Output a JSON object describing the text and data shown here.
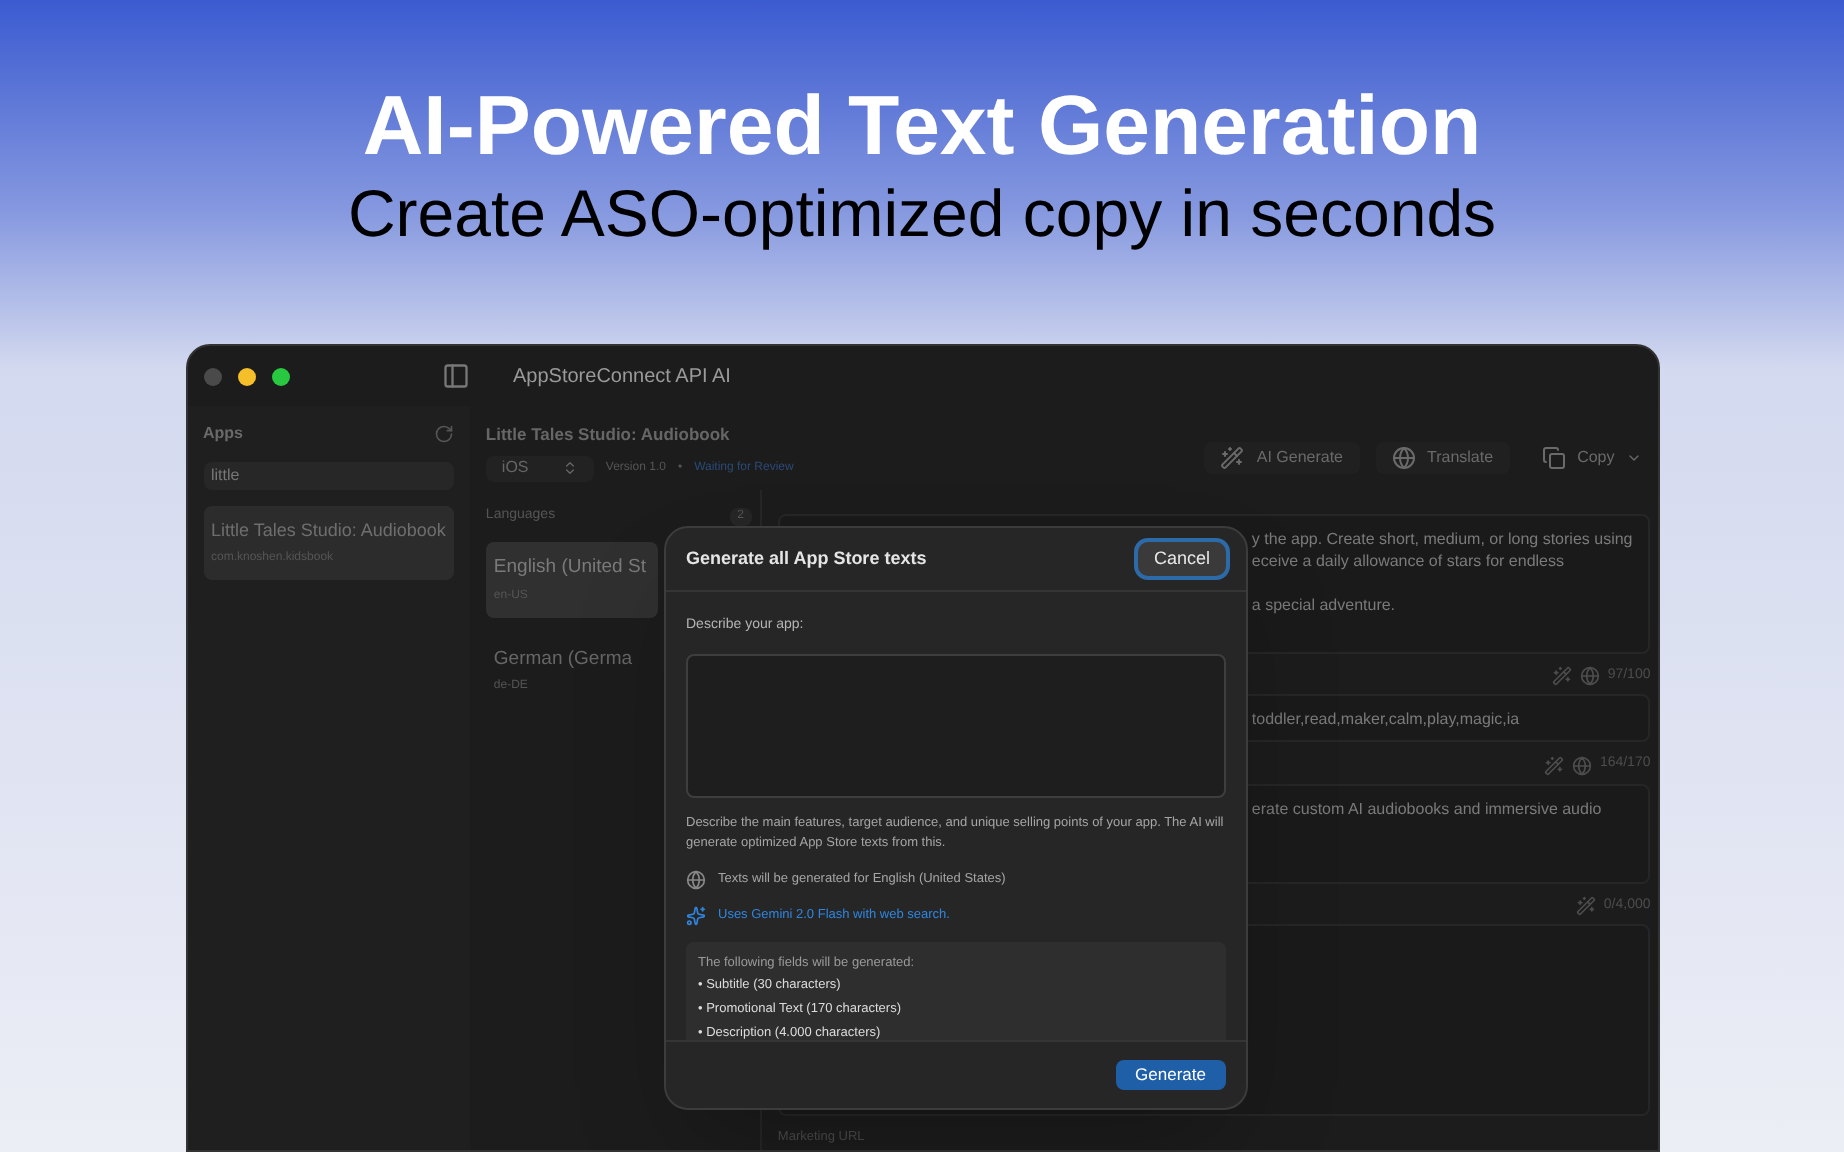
{
  "hero": {
    "title": "AI-Powered Text Generation",
    "subtitle": "Create ASO-optimized copy in seconds"
  },
  "window": {
    "title": "AppStoreConnect API AI"
  },
  "sidebar": {
    "heading": "Apps",
    "search": {
      "value": "little"
    },
    "items": [
      {
        "name": "Little Tales Studio: Audiobook",
        "bundle_id": "com.knoshen.kidsbook",
        "selected": true
      }
    ]
  },
  "app_header": {
    "name": "Little Tales Studio: Audiobook",
    "platform": "iOS",
    "version": "Version 1.0",
    "separator": "•",
    "status": "Waiting for Review"
  },
  "toolbar": [
    {
      "label": "AI Generate",
      "kind": "ai"
    },
    {
      "label": "Translate",
      "kind": "translate"
    },
    {
      "label": "Copy",
      "kind": "copy"
    }
  ],
  "languages": {
    "heading": "Languages",
    "count": "2",
    "items": [
      {
        "name": "English (United St",
        "code": "en-US",
        "selected": true
      },
      {
        "name": "German (Germa",
        "code": "de-DE",
        "selected": false
      }
    ]
  },
  "fields": [
    {
      "kind": "text",
      "paragraphs": [
        [
          "y the app. Create short, medium, or long stories using",
          "eceive a daily allowance of stars for endless"
        ],
        [
          "a special adventure."
        ]
      ]
    },
    {
      "kind": "keywords",
      "counter": "97/100",
      "paragraphs": [
        [
          "toddler,read,maker,calm,play,magic,ia"
        ]
      ]
    },
    {
      "kind": "promo",
      "counter": "164/170",
      "paragraphs": [
        [
          "erate custom AI audiobooks and immersive audio"
        ]
      ]
    },
    {
      "kind": "description",
      "counter": "0/4,000"
    }
  ],
  "marketing_label": "Marketing URL",
  "dialog": {
    "title": "Generate all App Store texts",
    "cancel": "Cancel",
    "prompt_label": "Describe your app:",
    "hint": "Describe the main features, target audience, and unique selling points of your app. The AI will generate optimized App Store texts from this.",
    "language_note": "Texts will be generated for English (United States)",
    "model_note": "Uses Gemini 2.0 Flash with web search.",
    "fields_heading": "The following fields will be generated:",
    "field_list": [
      "• Subtitle (30 characters)",
      "• Promotional Text (170 characters)",
      "• Description (4.000 characters)"
    ],
    "generate": "Generate"
  }
}
